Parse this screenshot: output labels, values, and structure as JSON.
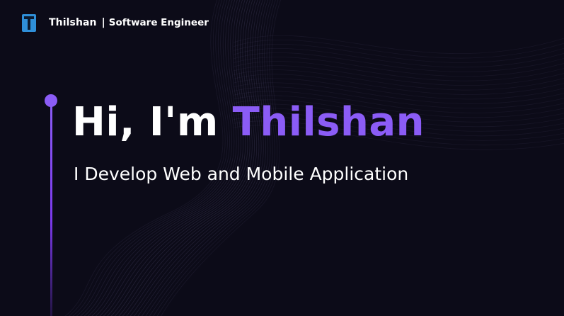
{
  "header": {
    "brand_name": "Thilshan",
    "separator": "|",
    "role": "Software Engineer",
    "logo_icon": "letter-t-logo-icon"
  },
  "hero": {
    "greeting": "Hi, I'm",
    "name": "Thilshan",
    "subtitle": "I Develop Web and Mobile Application"
  },
  "colors": {
    "background": "#0c0b18",
    "accent": "#8b5cf6",
    "text": "#ffffff",
    "logo_blue": "#2f8fd8"
  }
}
